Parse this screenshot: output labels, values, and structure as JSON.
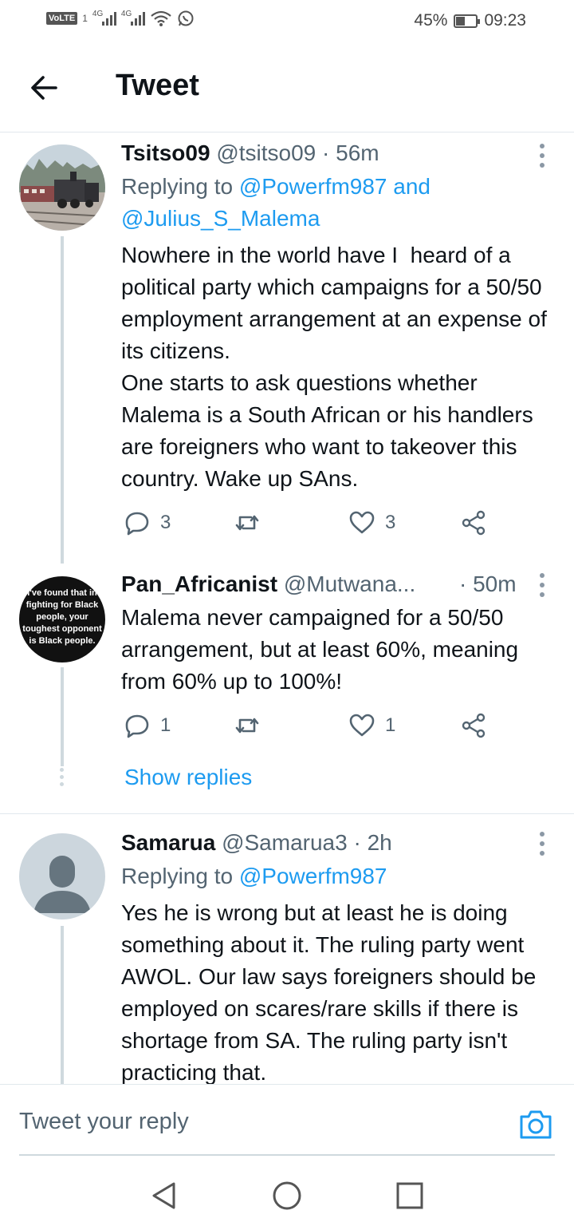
{
  "status_bar": {
    "volte": "VoLTE",
    "sim": "1",
    "net1": "4G",
    "net2": "4G",
    "battery_percent": "45%",
    "battery_level": 0.45,
    "time": "09:23"
  },
  "header": {
    "title": "Tweet"
  },
  "tweets": [
    {
      "name": "Tsitso09",
      "handle": "@tsitso09",
      "time": "· 56m",
      "replying_prefix": "Replying to ",
      "mentions": "@Powerfm987 and",
      "mentions2": "@Julius_S_Malema",
      "body": "Nowhere in the world have I  heard of a political party which campaigns for a 50/50 employment arrangement at an expense of its citizens.\nOne starts to ask questions whether Malema is a South African or his handlers are foreigners who want to takeover this country. Wake up SAns.",
      "replies": "3",
      "retweets": "",
      "likes": "3"
    },
    {
      "name": "Pan_Africanist",
      "handle": "@Mutwana...",
      "time": "· 50m",
      "avatar_text": "I've found that in fighting for Black people, your toughest opponent is Black people.",
      "body": "Malema never campaigned for a 50/50 arrangement, but at least 60%, meaning from 60% up to 100%!",
      "replies": "1",
      "retweets": "",
      "likes": "1",
      "show_replies": "Show replies"
    },
    {
      "name": "Samarua",
      "handle": "@Samarua3",
      "time": "· 2h",
      "replying_prefix": "Replying to ",
      "mentions": "@Powerfm987",
      "body": "Yes he is wrong but at least he is doing something about it. The ruling party went AWOL. Our law says foreigners should be employed on scares/rare skills if there is shortage from SA. The ruling party isn't practicing that."
    }
  ],
  "reply_bar": {
    "placeholder": "Tweet your reply"
  },
  "colors": {
    "accent": "#1d9bf0",
    "text": "#0f1419",
    "secondary": "#536471",
    "thread_line": "#cfd9de"
  }
}
